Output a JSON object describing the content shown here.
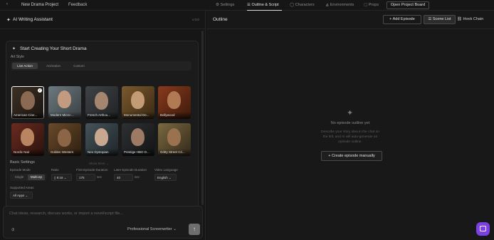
{
  "topbar": {
    "back_icon": "chevron-left-icon",
    "project_name": "New Drama Project",
    "feedback": "Feedback",
    "tabs": [
      {
        "icon": "gear-icon",
        "label": "Settings"
      },
      {
        "icon": "list-icon",
        "label": "Outline & Script"
      },
      {
        "icon": "user-icon",
        "label": "Characters"
      },
      {
        "icon": "mountain-icon",
        "label": "Environments"
      },
      {
        "icon": "box-icon",
        "label": "Props"
      }
    ],
    "active_tab": "Outline & Script",
    "open_board": "Open Project Board"
  },
  "assistant": {
    "icon": "sparkle-icon",
    "title": "AI Writing Assistant",
    "version": "v 0.0",
    "card_title": "Start Creating Your Short Drama",
    "art_style_label": "Art Style",
    "style_tabs": [
      "Live Action",
      "Animation",
      "Custom"
    ],
    "active_style_tab": "Live Action",
    "styles": [
      {
        "label": "American Cine...",
        "selected": true
      },
      {
        "label": "Modern Micro-...",
        "selected": false
      },
      {
        "label": "French Arthou...",
        "selected": false
      },
      {
        "label": "Monumental De...",
        "selected": false
      },
      {
        "label": "Bollywood",
        "selected": false
      },
      {
        "label": "Nordic Noir",
        "selected": false
      },
      {
        "label": "Golden Western",
        "selected": false
      },
      {
        "label": "Neo Dystopian",
        "selected": false
      },
      {
        "label": "Prestige HBO D...",
        "selected": false
      },
      {
        "label": "Gritty Street Cri...",
        "selected": false
      }
    ],
    "show_more": "Show More",
    "basic_settings": "Basic Settings",
    "episode_mode_label": "Episode Mode",
    "mode_single": "Single",
    "mode_multi": "Multi-ep",
    "ratio_label": "Ratio",
    "ratio_value": "9:16",
    "first_duration_label": "First Episode Duration",
    "first_duration_value": "175",
    "later_duration_label": "Later Episode Duration",
    "later_duration_value": "40",
    "sec_unit": "sec",
    "language_label": "Video Language",
    "language_value": "English",
    "platform_label": "Supported Areas",
    "platform_value": "All Apps",
    "chat_placeholder": "Chat ideas, research, discuss works, or import a novel/script file...",
    "attach_icon": "paperclip-icon",
    "persona": "Professional Screenwriter",
    "send_icon": "arrow-up-icon"
  },
  "outline": {
    "title": "Outline",
    "add_episode": "Add Episode",
    "scene_list": "Scene List",
    "hook_chain": "Hook Chain",
    "empty_icon": "sparkle-icon",
    "empty_title": "No episode outline yet",
    "empty_line1": "Describe your story idea in the chat on",
    "empty_line2": "the left, and AI will auto-generate an",
    "empty_line3": "episode outline.",
    "create_manual": "Create episode manually"
  },
  "colors": {
    "background": "#141414",
    "panel": "#181818",
    "accent_purple": "#7b3fe4",
    "border": "#2a2a2a"
  }
}
